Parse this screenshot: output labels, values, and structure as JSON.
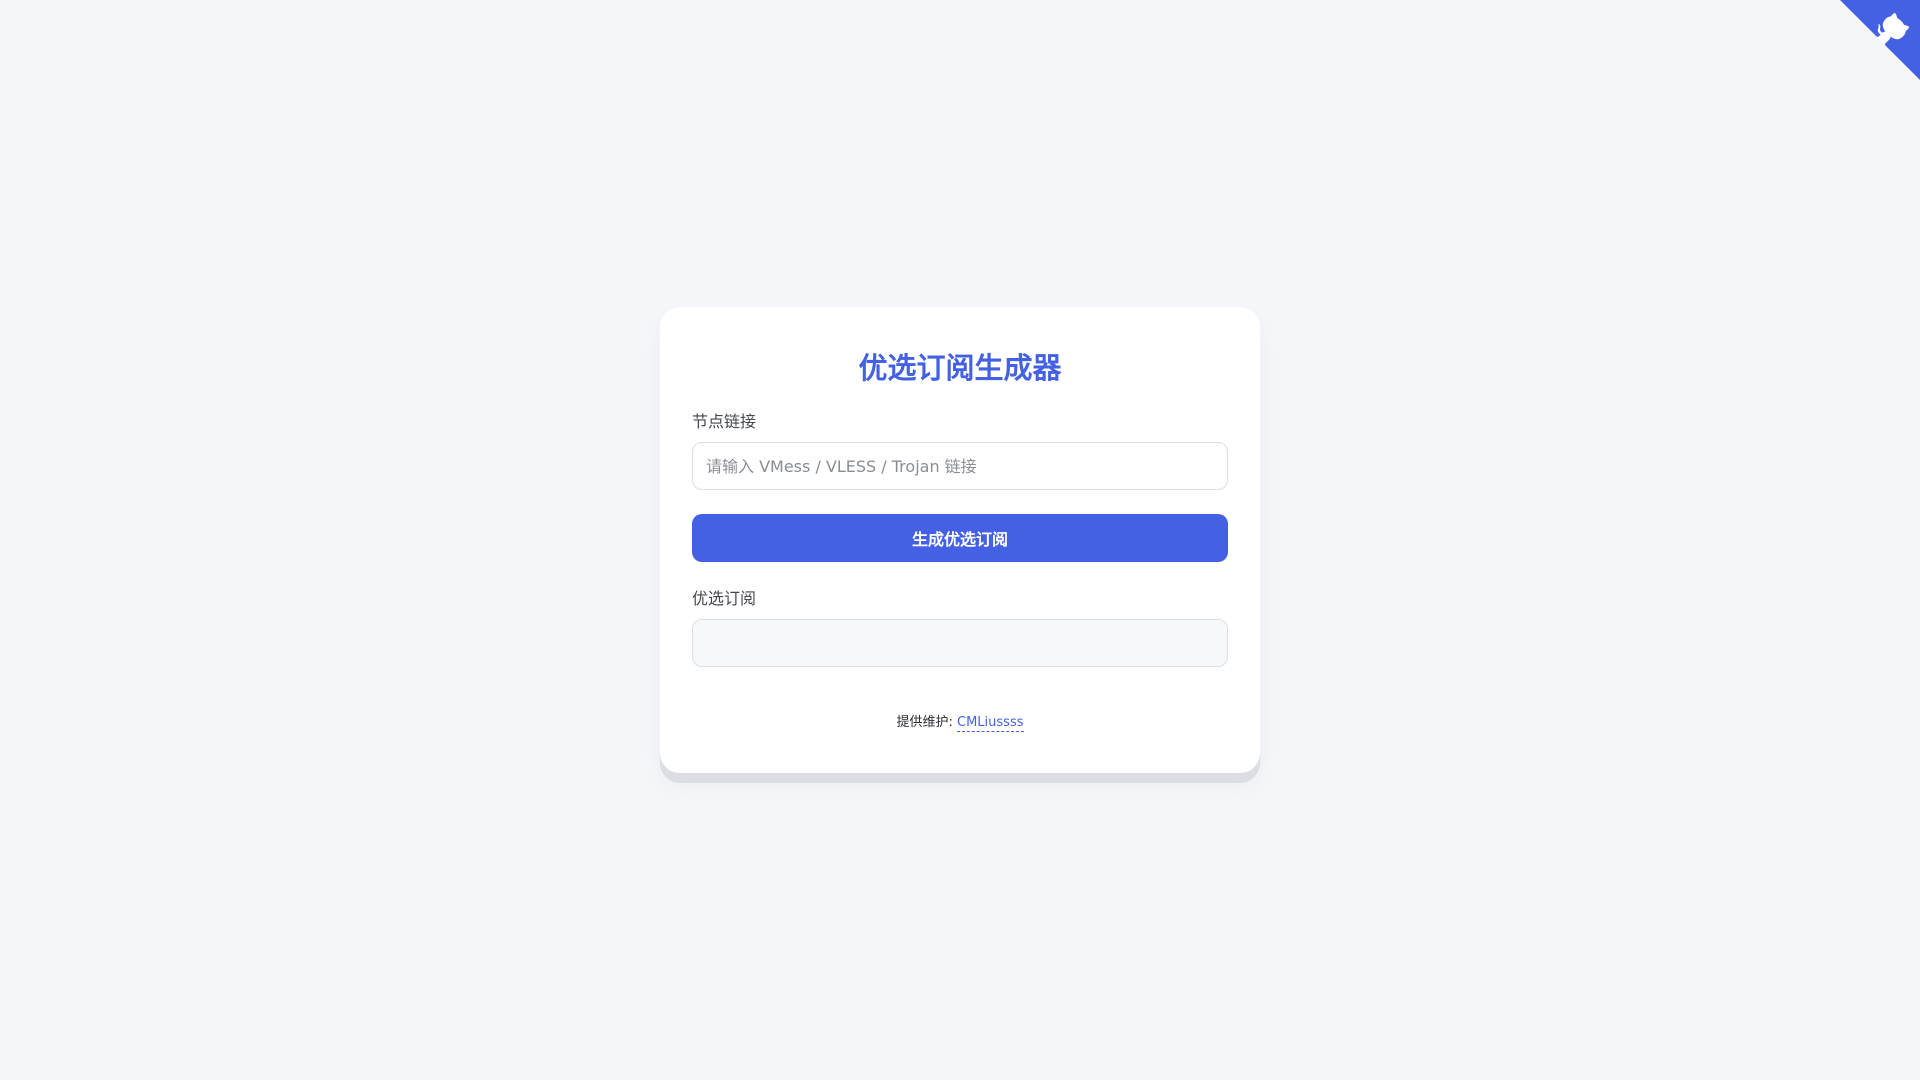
{
  "title": "优选订阅生成器",
  "node_link": {
    "label": "节点链接",
    "placeholder": "请输入 VMess / VLESS / Trojan 链接",
    "value": ""
  },
  "generate_button": {
    "label": "生成优选订阅"
  },
  "subscription": {
    "label": "优选订阅",
    "value": ""
  },
  "footer": {
    "prefix": "提供维护: ",
    "author": "CMLiussss"
  },
  "corner_icon": "github-octocat-icon",
  "colors": {
    "accent": "#4361e2",
    "background": "#f4f6f9",
    "card": "#ffffff"
  }
}
